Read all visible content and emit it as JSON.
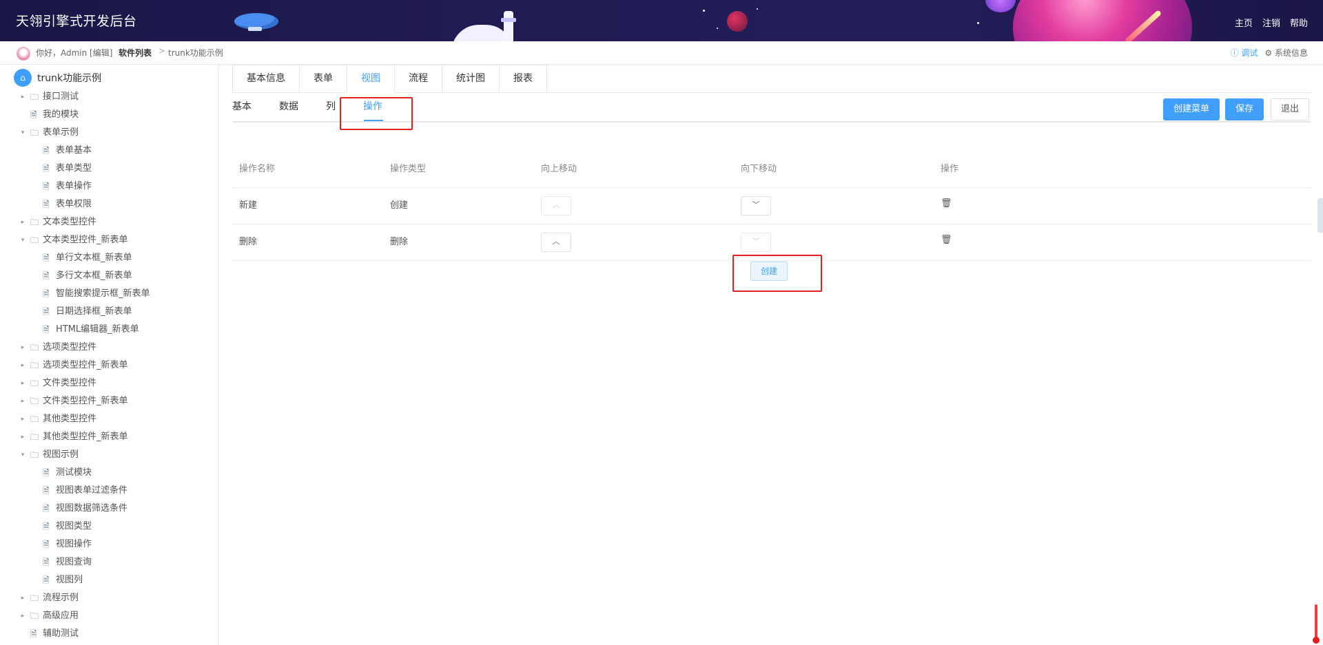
{
  "header": {
    "title": "天翎引擎式开发后台",
    "nav": [
      "主页",
      "注销",
      "帮助"
    ]
  },
  "breadcrumb": {
    "greeting": "你好，Admin [编辑]",
    "items": [
      "软件列表",
      "trunk功能示例"
    ],
    "separator": ">",
    "right": {
      "debug": "ⓘ 调试",
      "sysinfo": "⚙ 系统信息"
    }
  },
  "sidebar": {
    "root": "trunk功能示例",
    "items": [
      {
        "label": "接口测试",
        "level": 1,
        "type": "folder",
        "expanded": false
      },
      {
        "label": "我的模块",
        "level": 1,
        "type": "file"
      },
      {
        "label": "表单示例",
        "level": 1,
        "type": "folder",
        "expanded": true
      },
      {
        "label": "表单基本",
        "level": 2,
        "type": "file"
      },
      {
        "label": "表单类型",
        "level": 2,
        "type": "file"
      },
      {
        "label": "表单操作",
        "level": 2,
        "type": "file"
      },
      {
        "label": "表单权限",
        "level": 2,
        "type": "file"
      },
      {
        "label": "文本类型控件",
        "level": 1,
        "type": "folder",
        "expanded": false
      },
      {
        "label": "文本类型控件_新表单",
        "level": 1,
        "type": "folder",
        "expanded": true
      },
      {
        "label": "单行文本框_新表单",
        "level": 2,
        "type": "file"
      },
      {
        "label": "多行文本框_新表单",
        "level": 2,
        "type": "file"
      },
      {
        "label": "智能搜索提示框_新表单",
        "level": 2,
        "type": "file"
      },
      {
        "label": "日期选择框_新表单",
        "level": 2,
        "type": "file"
      },
      {
        "label": "HTML编辑器_新表单",
        "level": 2,
        "type": "file"
      },
      {
        "label": "选项类型控件",
        "level": 1,
        "type": "folder",
        "expanded": false
      },
      {
        "label": "选项类型控件_新表单",
        "level": 1,
        "type": "folder",
        "expanded": false
      },
      {
        "label": "文件类型控件",
        "level": 1,
        "type": "folder",
        "expanded": false
      },
      {
        "label": "文件类型控件_新表单",
        "level": 1,
        "type": "folder",
        "expanded": false
      },
      {
        "label": "其他类型控件",
        "level": 1,
        "type": "folder",
        "expanded": false
      },
      {
        "label": "其他类型控件_新表单",
        "level": 1,
        "type": "folder",
        "expanded": false
      },
      {
        "label": "视图示例",
        "level": 1,
        "type": "folder",
        "expanded": true
      },
      {
        "label": "测试模块",
        "level": 2,
        "type": "file"
      },
      {
        "label": "视图表单过滤条件",
        "level": 2,
        "type": "file"
      },
      {
        "label": "视图数据筛选条件",
        "level": 2,
        "type": "file"
      },
      {
        "label": "视图类型",
        "level": 2,
        "type": "file"
      },
      {
        "label": "视图操作",
        "level": 2,
        "type": "file"
      },
      {
        "label": "视图查询",
        "level": 2,
        "type": "file"
      },
      {
        "label": "视图列",
        "level": 2,
        "type": "file"
      },
      {
        "label": "流程示例",
        "level": 1,
        "type": "folder",
        "expanded": false
      },
      {
        "label": "高级应用",
        "level": 1,
        "type": "folder",
        "expanded": false
      },
      {
        "label": "辅助测试",
        "level": 1,
        "type": "file"
      }
    ]
  },
  "tabs": [
    "基本信息",
    "表单",
    "视图",
    "流程",
    "统计图",
    "报表"
  ],
  "active_tab": "视图",
  "subtabs": [
    "基本",
    "数据",
    "列",
    "操作"
  ],
  "active_subtab": "操作",
  "actions": {
    "create_menu": "创建菜单",
    "save": "保存",
    "exit": "退出"
  },
  "table": {
    "headers": [
      "操作名称",
      "操作类型",
      "向上移动",
      "向下移动",
      "操作"
    ],
    "rows": [
      {
        "name": "新建",
        "type": "创建"
      },
      {
        "name": "删除",
        "type": "删除"
      }
    ]
  },
  "create_button": "创建",
  "icons": {
    "home": "home-icon",
    "folder": "folder-icon",
    "file": "file-icon",
    "up": "chevron-up-icon",
    "down": "chevron-down-icon",
    "trash": "trash-icon"
  },
  "colors": {
    "accent": "#409eff",
    "banner": "#1a1747",
    "highlight": "#e02020"
  }
}
